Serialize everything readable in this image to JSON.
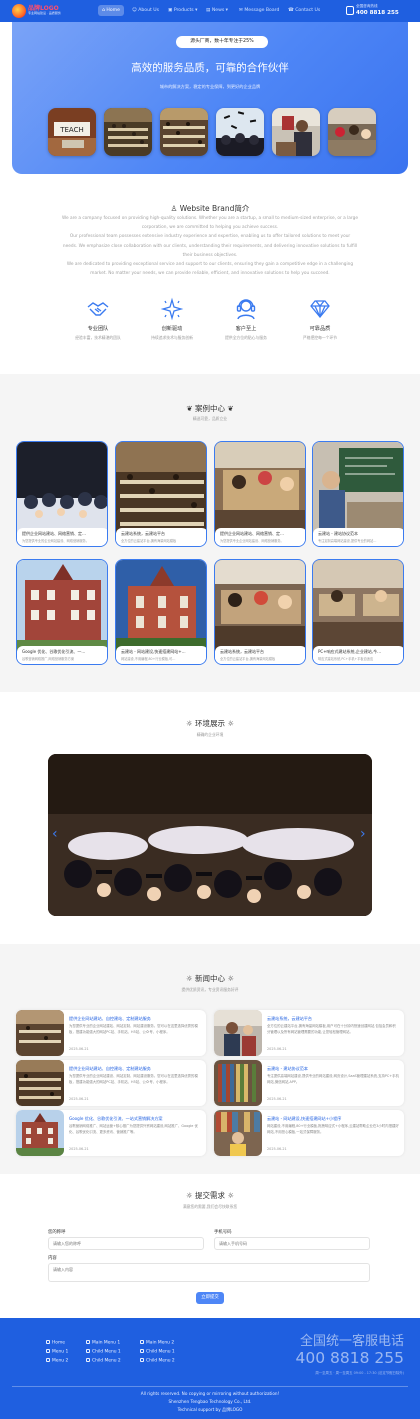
{
  "header": {
    "logo_text": "品牌LOGO",
    "logo_slogan": "专业网站建设 · 品质服务",
    "nav": [
      {
        "label": "Home",
        "active": true,
        "icon": "home-icon"
      },
      {
        "label": "About Us",
        "icon": "user-icon"
      },
      {
        "label": "Products ▾",
        "icon": "box-icon"
      },
      {
        "label": "News ▾",
        "icon": "news-icon"
      },
      {
        "label": "Message Board",
        "icon": "message-icon"
      },
      {
        "label": "Contact Us",
        "icon": "contact-icon"
      }
    ],
    "hotline_label": "全国咨询热线",
    "hotline_number": "400 8818 255"
  },
  "hero": {
    "badge": "源头厂商，数十年专注于25%",
    "title": "高效的服务品质，可靠的合作伙伴",
    "subtitle": "城市的解决方案，稳定的专业保障，到更好的企业品牌"
  },
  "brand": {
    "title": "Website Brand简介",
    "paragraphs": [
      "We are a company focused on providing high-quality solutions. Whether you are a startup, a small to medium-sized enterprise, or a large corporation, we are committed to helping you achieve success.",
      "Our professional team possesses extensive industry experience and expertise, enabling us to offer tailored solutions to meet your needs. We emphasize close collaboration with our clients, understanding their requirements, and delivering innovative solutions to fulfill their business objectives.",
      "We are dedicated to providing exceptional service and support to our clients, ensuring they gain a competitive edge in a challenging market. No matter your needs, we can provide reliable, efficient, and innovative solutions to help you succeed."
    ],
    "features": [
      {
        "title": "专业团队",
        "desc": "经验丰富，技术精湛的团队",
        "icon": "handshake-icon"
      },
      {
        "title": "创新驱动",
        "desc": "持续追求技术与服务创新",
        "icon": "sparkle-icon"
      },
      {
        "title": "客户至上",
        "desc": "提供全方位的贴心与服务",
        "icon": "headset-icon"
      },
      {
        "title": "可靠品质",
        "desc": "严格把控每一个环节",
        "icon": "diamond-icon"
      }
    ]
  },
  "cases": {
    "title": "案例中心",
    "subtitle": "精选可靠，品质立业",
    "items": [
      {
        "title": "提供企业网站建站、网络营销、定…",
        "desc": "为您提供专业的企业网站建设、网络营销服务。"
      },
      {
        "title": "云建站系统，云建站平台",
        "desc": "全方位的云建站平台,拥有海量网站模板"
      },
      {
        "title": "提供企业网站建站、网络营销、定…",
        "desc": "为您提供专业企业网站建设、网络营销服务。"
      },
      {
        "title": "云建站 - 建站协议范本",
        "desc": "专注定制高端网站建设,提供专业的网站…"
      },
      {
        "title": "Google 优化、谷歌优化引流、一…",
        "desc": "谷歌营销网络推广,网络营销服务方案"
      },
      {
        "title": "云建站 - 网站建设,快速搭建网站+…",
        "desc": "网站建设,不用编程,80+行业模板,可…"
      },
      {
        "title": "云建站系统，云建站平台",
        "desc": "全方位的云建站平台,拥有海量网站模板"
      },
      {
        "title": "PC+响应式建站系统,企业建站,今…",
        "desc": "响应式建站系统,PC+手机+平板自适应"
      }
    ]
  },
  "environment": {
    "title": "环境展示",
    "subtitle": "精确的企业环境",
    "prev": "‹",
    "next": "›"
  },
  "news": {
    "title": "新闻中心",
    "subtitle": "提供优质资讯，专业资讯服务好评",
    "items": [
      {
        "title": "提供企业网站建站、自控建站、定制建站服务",
        "desc": "为您提供专业的企业网站建站、网站定制、网站建设服务。您可以在这里选择优秀的模板，搭建功能强大的网站PC站、手机站、H5站、公众号、小程序。",
        "date": "2025-06-21"
      },
      {
        "title": "云建站系统，云建站平台",
        "desc": "全方位的云建站平台,拥有海量网站模板,用户可在十分钟内快速创建网站,包括会员和积分管理以及所有网站管理需要的功能,让您轻松管理网站。",
        "date": "2025-06-21"
      },
      {
        "title": "提供企业网站建站、自控建站、定制建站服务",
        "desc": "为您提供专业的企业网站建设、网站定制、网站建设服务。您可以在这里选择优秀的模板，搭建功能强大的网站PC站、手机站、H5站、公众号、小程序。",
        "date": "2025-06-21"
      },
      {
        "title": "云建站 - 建站协议范本",
        "desc": "专注提供高端网站建设,提供专业的网站建设,网页设计,SaaS管理建站系统,支持PC+手机网站,微信网站,APP。",
        "date": "2025-06-21"
      },
      {
        "title": "Google 优化、谷歌优化引流、一站式营销解决方案",
        "desc": "谷歌营销网络推广、网站运营+核心推广为您提供外贸网站建设,网站推广、Google 优化、谷歌优化引流、更多资讯、营销推广等。",
        "date": "2025-06-21"
      },
      {
        "title": "云建站 - 网站建设,快速搭建网站+小程序",
        "desc": "网站建设,不用编程,80+行业模板,拖拽响应式+小程序,云建站帮助企业在3小时内搭建好网站,不用担心模板,一站式保障服务。",
        "date": "2025-06-21"
      }
    ]
  },
  "inquiry": {
    "title": "提交需求",
    "subtitle": "满意您的需要,我们会尽快联系您",
    "name_label": "您的称呼",
    "name_placeholder": "请输入您的称呼",
    "phone_label": "手机号码",
    "phone_placeholder": "请输入手机号码",
    "content_label": "内容",
    "content_placeholder": "请输入内容",
    "submit_label": "立即提交"
  },
  "footer": {
    "links": [
      {
        "label": "Home",
        "icon": "home-icon"
      },
      {
        "label": "Main Menu 1",
        "icon": "menu-icon"
      },
      {
        "label": "Main Menu 2",
        "icon": "menu-icon"
      },
      {
        "label": "Menu 1",
        "icon": "menu-icon"
      },
      {
        "label": "Child Menu 1",
        "icon": "menu-icon"
      },
      {
        "label": "Child Menu 1",
        "icon": "menu-icon"
      },
      {
        "label": "Menu 2",
        "icon": "menu-icon"
      },
      {
        "label": "Child Menu 2",
        "icon": "menu-icon"
      },
      {
        "label": "Child Menu 2",
        "icon": "menu-icon"
      }
    ],
    "hotline_title": "全国统一客服电话",
    "hotline_number": "400 8818 255",
    "hotline_meta": "周一至周五 · 周一至周五 09:00 - 17:30 (法定节假日除外)",
    "rights": "All rights reserved. No copying or mirroring without authorization!",
    "company": "Shenzhen Tengbao Technology Co., Ltd.",
    "support": "Technical support by 品牌LOGO"
  },
  "colors": {
    "primary": "#1f5fe0",
    "accent": "#4e86f6",
    "hero_gradient_start": "#7aa3f7",
    "hero_gradient_end": "#3a73ef",
    "section_bg": "#f5f5f5"
  }
}
